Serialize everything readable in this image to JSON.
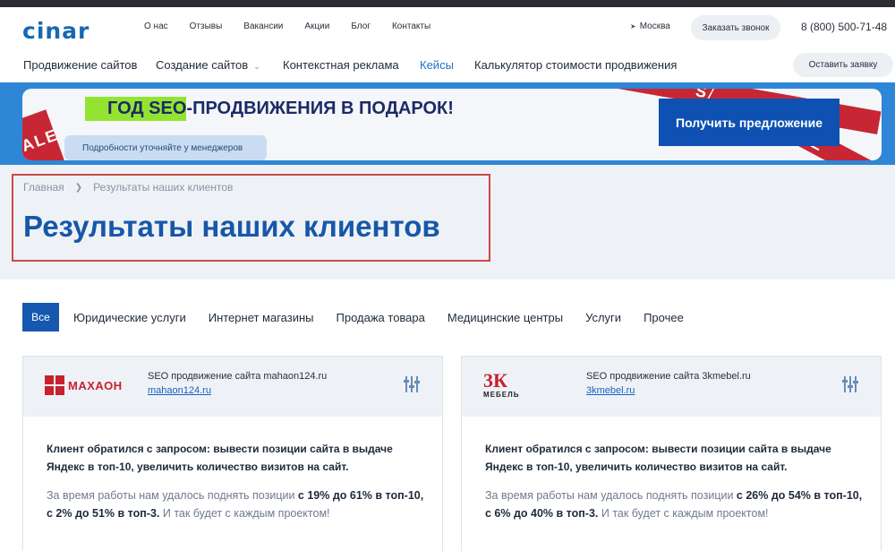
{
  "header": {
    "logo": "cinar",
    "nav": [
      "О нас",
      "Отзывы",
      "Вакансии",
      "Акции",
      "Блог",
      "Контакты"
    ],
    "city": "Москва",
    "callback_button": "Заказать звонок",
    "phone": "8 (800) 500-71-48"
  },
  "main_nav": {
    "items": [
      "Продвижение сайтов",
      "Создание сайтов",
      "Контекстная реклама",
      "Кейсы",
      "Калькулятор стоимости продвижения"
    ],
    "active": "Кейсы",
    "apply_button": "Оставить заявку"
  },
  "banner": {
    "title_highlight": "ГОД SEO",
    "title_rest": "-ПРОДВИЖЕНИЯ В ПОДАРОК!",
    "subtitle": "Подробности уточняйте у менеджеров",
    "cta": "Получить предложение",
    "ribbon_text": "SALE"
  },
  "breadcrumb": {
    "home": "Главная",
    "current": "Результаты наших клиентов"
  },
  "page_title": "Результаты наших клиентов",
  "filters": [
    "Все",
    "Юридические услуги",
    "Интернет магазины",
    "Продажа товара",
    "Медицинские центры",
    "Услуги",
    "Прочее"
  ],
  "cards": [
    {
      "logo_text": "МАХАОН",
      "title": "SEO продвижение сайта mahaon124.ru",
      "link": "mahaon124.ru",
      "request": "Клиент обратился с запросом: вывести позиции сайта в выдаче Яндекс в топ-10, увеличить количество визитов на сайт.",
      "result_prefix": "За время работы нам удалось поднять позиции ",
      "result_bold": "с 19% до 61% в топ-10, с 2% до 51% в топ-3.",
      "result_suffix": " И так будет с каждым проектом!"
    },
    {
      "logo_text": "3К",
      "logo_sub": "МЕБЕЛЬ",
      "title": "SEO продвижение сайта 3kmebel.ru",
      "link": "3kmebel.ru",
      "request": "Клиент обратился с запросом: вывести позиции сайта в выдаче Яндекс в топ-10, увеличить количество визитов на сайт.",
      "result_prefix": "За время работы нам удалось поднять позиции ",
      "result_bold": "с 26% до 54% в топ-10, с 6% до 40% в топ-3.",
      "result_suffix": " И так будет с каждым проектом!"
    }
  ]
}
